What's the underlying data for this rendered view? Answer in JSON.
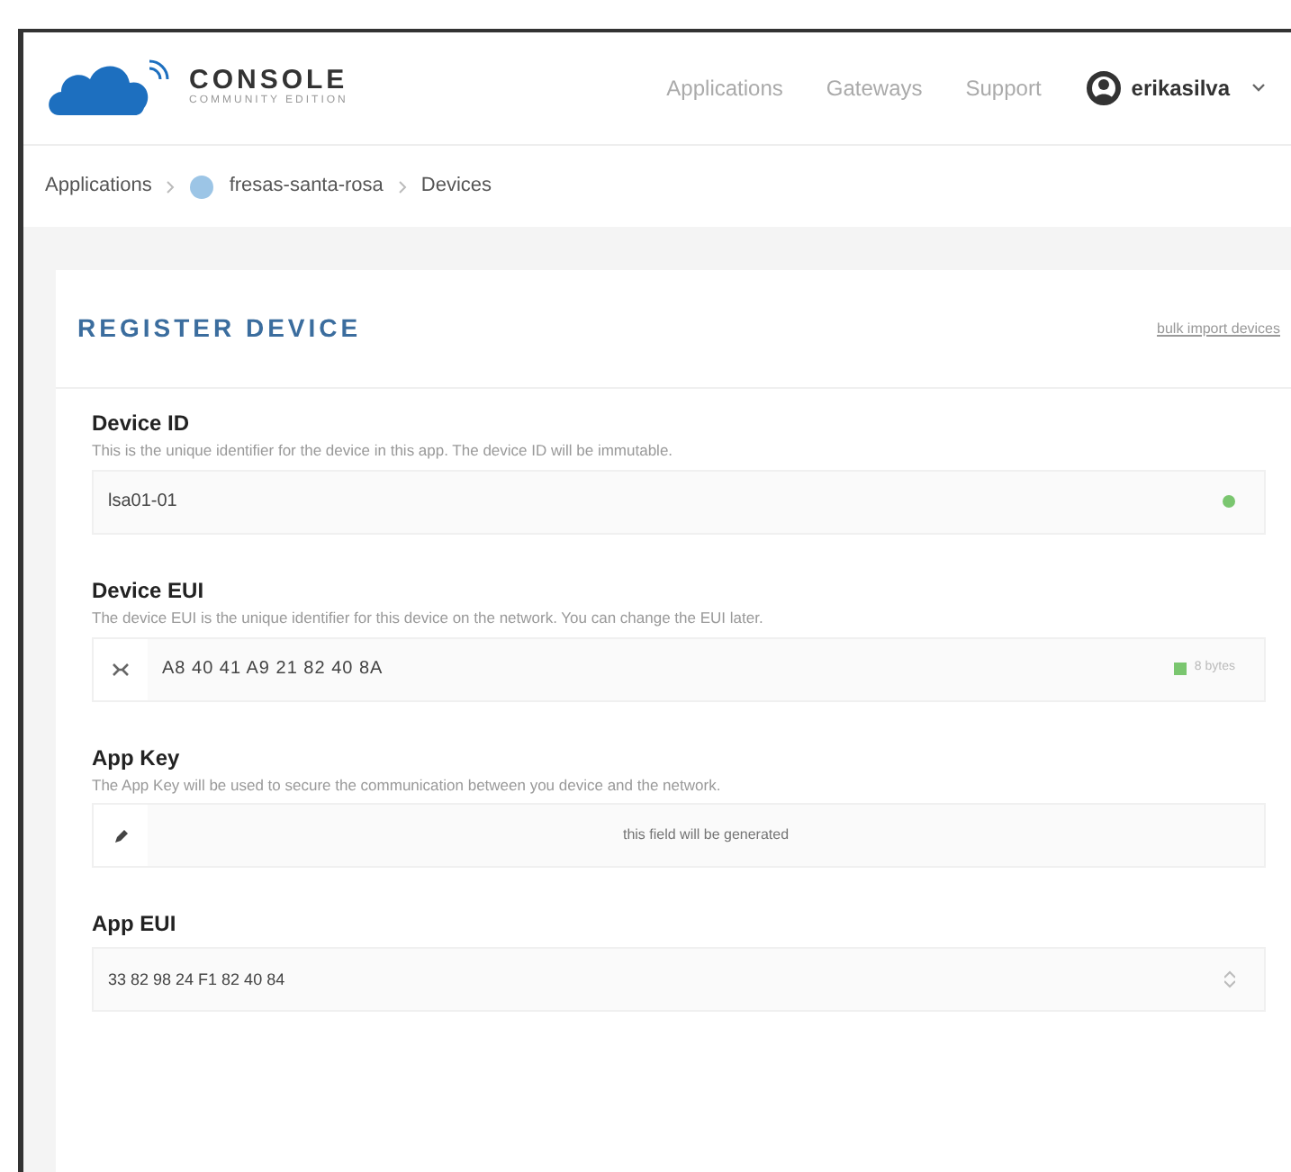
{
  "header": {
    "logo_title": "CONSOLE",
    "logo_subtitle": "COMMUNITY EDITION",
    "nav": [
      {
        "label": "Applications"
      },
      {
        "label": "Gateways"
      },
      {
        "label": "Support"
      }
    ],
    "user": "erikasilva"
  },
  "breadcrumb": [
    "Applications",
    "fresas-santa-rosa",
    "Devices"
  ],
  "card": {
    "title": "REGISTER DEVICE",
    "action": "bulk import devices",
    "fields": [
      {
        "kind": "text",
        "label": "Device ID",
        "description": "This is the unique identifier for the device in this app. The device ID will be immutable.",
        "value": "lsa01-01",
        "valid": true
      },
      {
        "kind": "eui",
        "label": "Device EUI",
        "description": "The device EUI is the unique identifier for this device on the network. You can change the EUI later.",
        "value": "A8 40 41 A9 21 82 40 8A",
        "valid": true,
        "hint": "8 bytes"
      },
      {
        "kind": "generated",
        "label": "App Key",
        "description": "The App Key will be used to secure the communication between you device and the network.",
        "placeholder": "this field will be generated"
      },
      {
        "kind": "select",
        "label": "App EUI",
        "value": "33 82 98 24 F1 82 40 84"
      }
    ]
  }
}
